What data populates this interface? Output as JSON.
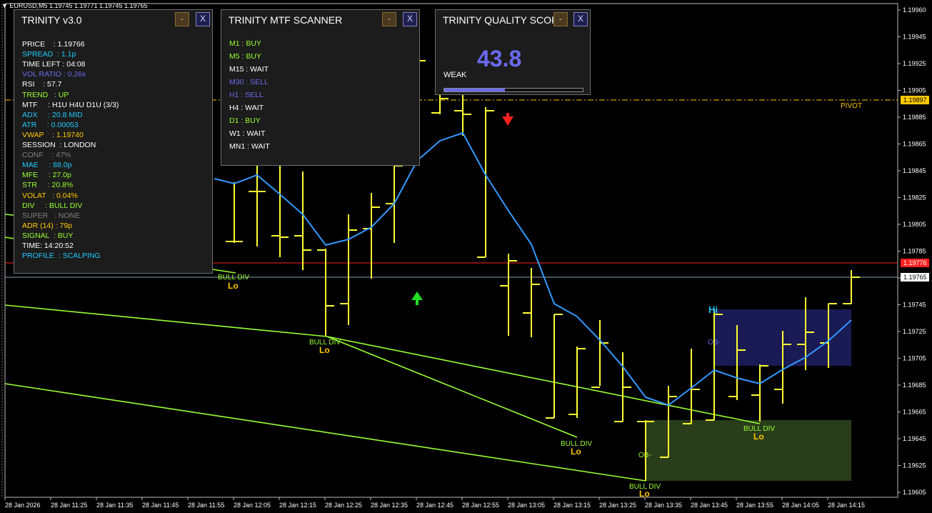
{
  "symbol_line": "EURUSD,M5  1.19745 1.19771 1.19745 1.19765",
  "chart": {
    "y_ticks": [
      "1.19960",
      "1.19945",
      "1.19925",
      "1.19905",
      "1.19885",
      "1.19865",
      "1.19845",
      "1.19825",
      "1.19805",
      "1.19785",
      "1.19765",
      "1.19745",
      "1.19725",
      "1.19705",
      "1.19685",
      "1.19665",
      "1.19645",
      "1.19625",
      "1.19605"
    ],
    "x_ticks": [
      "28 Jan 2026",
      "28 Jan 11:25",
      "28 Jan 11:35",
      "28 Jan 11:45",
      "28 Jan 11:55",
      "28 Jan 12:05",
      "28 Jan 12:15",
      "28 Jan 12:25",
      "28 Jan 12:35",
      "28 Jan 12:45",
      "28 Jan 12:55",
      "28 Jan 13:05",
      "28 Jan 13:15",
      "28 Jan 13:25",
      "28 Jan 13:35",
      "28 Jan 13:45",
      "28 Jan 13:55",
      "28 Jan 14:05",
      "28 Jan 14:15"
    ],
    "pivot_label": "PIVOT",
    "pivot_price": "1.19897",
    "current_price": "1.19765",
    "red_line_price": "1.19776",
    "bull_div_label": "BULL DIV",
    "lo_label": "Lo",
    "hi_label": "Hi",
    "ob_label": "OB-",
    "colors": {
      "bars": "#ffff33",
      "ma": "#3399ff",
      "divlines": "#99ff33",
      "pivot": "#ffc800",
      "red": "#ff2020",
      "current": "#c0c0c0"
    }
  },
  "trinity": {
    "title": "TRINITY v3.0",
    "min_label": "-",
    "close_label": "X",
    "rows": [
      {
        "text": "PRICE    : 1.19766",
        "color": "#ffffff"
      },
      {
        "text": "SPREAD  : 1.1p",
        "color": "#22c8ff"
      },
      {
        "text": "TIME LEFT : 04:08",
        "color": "#ffffff"
      },
      {
        "text": "VOL RATIO : 0.26x",
        "color": "#6a6af0"
      },
      {
        "text": "RSI    : 57.7",
        "color": "#ffffff"
      },
      {
        "text": "TREND   : UP",
        "color": "#99ff33"
      },
      {
        "text": "MTF     : H1U H4U D1U (3/3)",
        "color": "#ffffff"
      },
      {
        "text": "ADX     : 20.8 MID",
        "color": "#22c8ff"
      },
      {
        "text": "ATR     : 0.00053",
        "color": "#22c8ff"
      },
      {
        "text": "VWAP    : 1.19740",
        "color": "#ffc800"
      },
      {
        "text": "SESSION  : LONDON",
        "color": "#ffffff"
      },
      {
        "text": "CONF    : 47%",
        "color": "#808080"
      },
      {
        "text": "MAE     : 88.0p",
        "color": "#22c8ff"
      },
      {
        "text": "MFE     : 27.0p",
        "color": "#99ff33"
      },
      {
        "text": "STR     : 20.8%",
        "color": "#99ff33"
      },
      {
        "text": "VOLAT   : 0.04%",
        "color": "#ffc800"
      },
      {
        "text": "DIV     : BULL DIV",
        "color": "#99ff33"
      },
      {
        "text": "SUPER   : NONE",
        "color": "#808080"
      },
      {
        "text": "ADR (14) : 79p",
        "color": "#ffc800"
      },
      {
        "text": "SIGNAL  : BUY",
        "color": "#99ff33"
      },
      {
        "text": "TIME: 14:20:52",
        "color": "#ffffff"
      },
      {
        "text": "PROFILE  : SCALPING",
        "color": "#22c8ff"
      }
    ]
  },
  "mtf": {
    "title": "TRINITY MTF SCANNER",
    "min_label": "-",
    "close_label": "X",
    "rows": [
      {
        "text": "M1  : BUY",
        "color": "#99ff33"
      },
      {
        "text": "M5  : BUY",
        "color": "#99ff33"
      },
      {
        "text": "M15 : WAIT",
        "color": "#ffffff"
      },
      {
        "text": "M30 : SELL",
        "color": "#6a6af0"
      },
      {
        "text": "H1  : SELL",
        "color": "#6a6af0"
      },
      {
        "text": "H4  : WAIT",
        "color": "#ffffff"
      },
      {
        "text": "D1  : BUY",
        "color": "#99ff33"
      },
      {
        "text": "W1  : WAIT",
        "color": "#ffffff"
      },
      {
        "text": "MN1 : WAIT",
        "color": "#ffffff"
      }
    ]
  },
  "quality": {
    "title": "TRINITY QUALITY SCORE",
    "min_label": "-",
    "close_label": "X",
    "score": "43.8",
    "label": "WEAK",
    "fill_fraction": 0.438
  }
}
